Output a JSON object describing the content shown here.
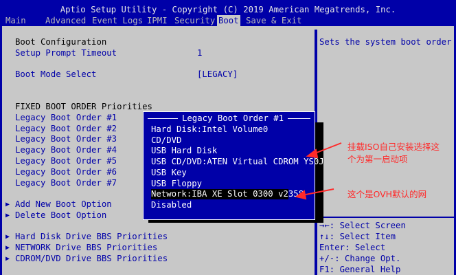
{
  "title": "Aptio Setup Utility - Copyright (C) 2019 American Megatrends, Inc.",
  "menu": [
    "Main",
    "Advanced",
    "Event Logs",
    "IPMI",
    "Security",
    "Boot",
    "Save & Exit"
  ],
  "active_menu": "Boot",
  "left": {
    "boot_configuration": "Boot Configuration",
    "setup_prompt_timeout_label": "Setup Prompt Timeout",
    "setup_prompt_timeout_value": "1",
    "boot_mode_select_label": "Boot Mode Select",
    "boot_mode_select_value": "[LEGACY]",
    "fixed_boot_order_heading": "FIXED BOOT ORDER Priorities",
    "legacy_boot_orders": [
      "Legacy Boot Order #1",
      "Legacy Boot Order #2",
      "Legacy Boot Order #3",
      "Legacy Boot Order #4",
      "Legacy Boot Order #5",
      "Legacy Boot Order #6",
      "Legacy Boot Order #7"
    ],
    "add_new_boot_option": "Add New Boot Option",
    "delete_boot_option": "Delete Boot Option",
    "hdd_bbs": "Hard Disk Drive BBS Priorities",
    "network_bbs": "NETWORK Drive BBS Priorities",
    "cdrom_bbs": "CDROM/DVD Drive BBS Priorities"
  },
  "popup": {
    "title": "Legacy Boot Order #1",
    "items": [
      "Hard Disk:Intel Volume0",
      "CD/DVD",
      "USB Hard Disk",
      "USB CD/DVD:ATEN Virtual CDROM YS0J",
      "USB Key",
      "USB Floppy",
      "Network:IBA XE Slot 0300 v2358",
      "Disabled"
    ],
    "selected_index": 6
  },
  "right": {
    "help_text": "Sets the system boot order",
    "keys": [
      "→←: Select Screen",
      "↑↓: Select Item",
      "Enter: Select",
      "+/-: Change Opt.",
      "F1: General Help"
    ]
  },
  "annotations": {
    "iso_line1": "挂载ISO自己安装选择这",
    "iso_line2": "个为第一启动项",
    "ovh_note": "这个是OVH默认的网"
  },
  "colors": {
    "bios_blue": "#0000a8",
    "panel_gray": "#c8c8c8",
    "annotation_red": "#ff2a2a"
  }
}
